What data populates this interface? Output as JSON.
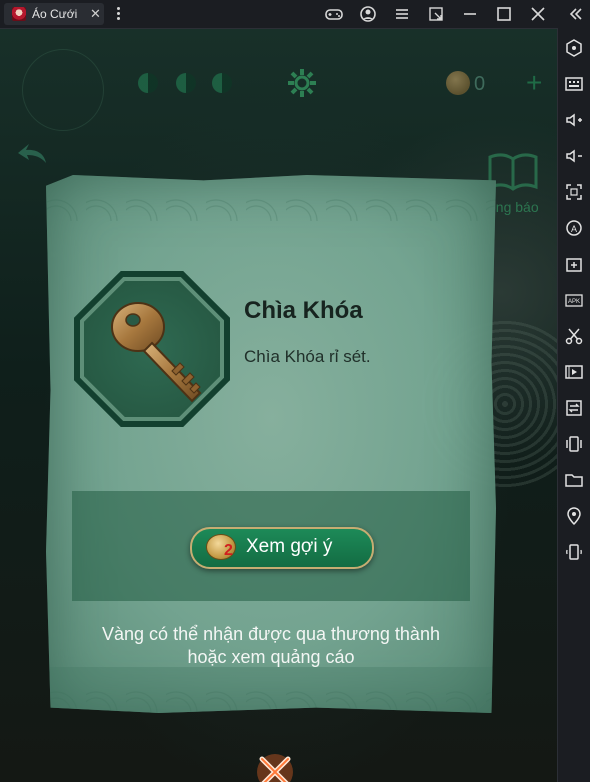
{
  "window": {
    "tab_title": "Áo Cưới",
    "tab_close": "✕"
  },
  "hud": {
    "coin_count": "0",
    "notice_label": "ông báo"
  },
  "dialog": {
    "item_title": "Chìa Khóa",
    "item_description": "Chìa Khóa rỉ sét.",
    "hint_cost": "2",
    "hint_label": "Xem gợi ý",
    "info_line1": "Vàng có thể nhận được qua thương thành",
    "info_line2": "hoặc xem quảng cáo"
  },
  "colors": {
    "dialog_bg": "#8fb9a6",
    "button_green": "#1d8a58",
    "button_border": "#c6ad72",
    "cost_red": "#d11f1f"
  }
}
